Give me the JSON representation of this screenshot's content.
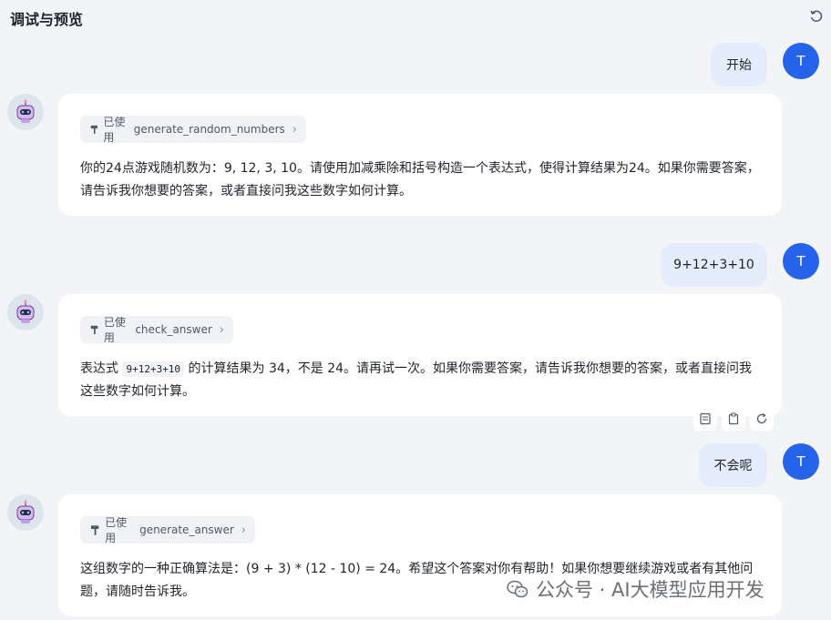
{
  "header": {
    "title": "调试与预览"
  },
  "messages": [
    {
      "role": "user",
      "text": "开始",
      "avatar": "T"
    },
    {
      "role": "bot",
      "tool_used_label": "已使用",
      "tool_name": "generate_random_numbers",
      "text": "你的24点游戏随机数为：9, 12, 3, 10。请使用加减乘除和括号构造一个表达式，使得计算结果为24。如果你需要答案，请告诉我你想要的答案，或者直接问我这些数字如何计算。"
    },
    {
      "role": "user",
      "text": "9+12+3+10",
      "avatar": "T"
    },
    {
      "role": "bot",
      "tool_used_label": "已使用",
      "tool_name": "check_answer",
      "text_before": "表达式",
      "code": "9+12+3+10",
      "text_after": "的计算结果为 34，不是 24。请再试一次。如果你需要答案，请告诉我你想要的答案，或者直接问我这些数字如何计算。"
    },
    {
      "role": "user",
      "text": "不会呢",
      "avatar": "T"
    },
    {
      "role": "bot",
      "tool_used_label": "已使用",
      "tool_name": "generate_answer",
      "text": "这组数字的一种正确算法是：(9 + 3) * (12 - 10) = 24。希望这个答案对你有帮助！如果你想要继续游戏或者有其他问题，请随时告诉我。"
    }
  ],
  "actions": [
    "notes-icon",
    "copy-icon",
    "regenerate-icon"
  ],
  "watermark": {
    "text": "公众号 · AI大模型应用开发"
  },
  "colors": {
    "accent": "#2563eb",
    "user_bubble": "#e5edfc",
    "background": "#f3f4f7"
  }
}
